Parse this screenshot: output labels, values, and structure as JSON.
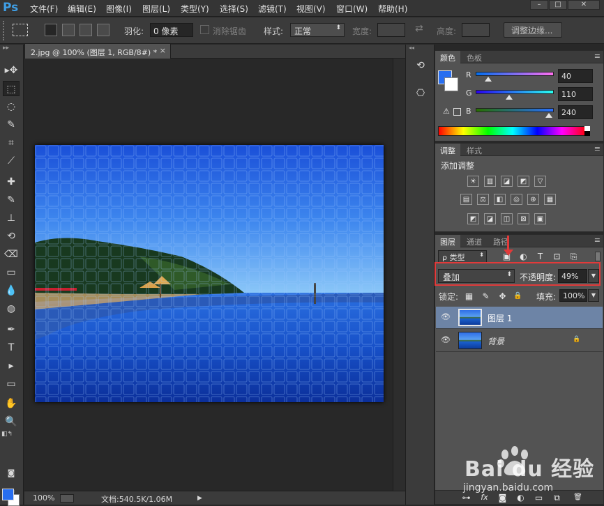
{
  "app": {
    "logo": "Ps"
  },
  "menu": [
    "文件(F)",
    "编辑(E)",
    "图像(I)",
    "图层(L)",
    "类型(Y)",
    "选择(S)",
    "滤镜(T)",
    "视图(V)",
    "窗口(W)",
    "帮助(H)"
  ],
  "window_controls": {
    "minimize": "–",
    "restore": "□",
    "close": "✕"
  },
  "options": {
    "feather_label": "羽化:",
    "feather_value": "0 像素",
    "antialias_label": "消除锯齿",
    "style_label": "样式:",
    "style_value": "正常",
    "width_label": "宽度:",
    "height_label": "高度:",
    "swap_icon": "⇄",
    "refine_edge_button": "调整边缘..."
  },
  "document": {
    "tab_title": "2.jpg @ 100% (图层 1, RGB/8#) *",
    "tab_close": "×"
  },
  "status": {
    "zoom": "100%",
    "doc_size": "文档:540.5K/1.06M",
    "arrow": "▶"
  },
  "color_panel": {
    "tabs": [
      "颜色",
      "色板"
    ],
    "channels": [
      {
        "label": "R",
        "value": "40",
        "fraction": 0.157
      },
      {
        "label": "G",
        "value": "110",
        "fraction": 0.431
      },
      {
        "label": "B",
        "value": "240",
        "fraction": 0.941
      }
    ],
    "warning_icon": "⚠",
    "foreground": "#286ef0",
    "background": "#ffffff"
  },
  "adjust_panel": {
    "tabs": [
      "调整",
      "样式"
    ],
    "title": "添加调整",
    "icons_row1": [
      "☀",
      "▥",
      "◪",
      "◩",
      "▽"
    ],
    "icons_row2": [
      "▤",
      "⚖",
      "◧",
      "◎",
      "⊕",
      "▦"
    ],
    "icons_row3": [
      "◩",
      "◪",
      "◫",
      "⊠",
      "▣"
    ]
  },
  "layers_panel": {
    "tabs": [
      "图层",
      "通道",
      "路径"
    ],
    "filter_label": "ρ 类型",
    "filter_icons": [
      "▣",
      "◐",
      "T",
      "⊡",
      "⎘"
    ],
    "blend_mode": "叠加",
    "opacity_label": "不透明度:",
    "opacity_value": "49%",
    "lock_label": "锁定:",
    "lock_icons": [
      "▦",
      "✎",
      "✥",
      "🔒"
    ],
    "fill_label": "填充:",
    "fill_value": "100%",
    "layers": [
      {
        "name": "图层 1",
        "selected": true,
        "visible_icon": "👁"
      },
      {
        "name": "背景",
        "selected": false,
        "visible_icon": "👁",
        "lock_icon": "🔒"
      }
    ],
    "footer_icons": [
      "⊶",
      "fx",
      "◙",
      "◐",
      "▭",
      "⧉",
      "🗑"
    ]
  },
  "tools": [
    "▸✥",
    "⬚",
    "◌",
    "✎",
    "⌗",
    "⟋",
    "✚",
    "✎",
    "⊥",
    "⌫",
    "▭",
    "💧",
    "◍",
    "✒",
    "T",
    "▸",
    "▭",
    "✋",
    "🔍"
  ],
  "watermark": {
    "brand": "Bai du 经验",
    "url": "jingyan.baidu.com"
  }
}
